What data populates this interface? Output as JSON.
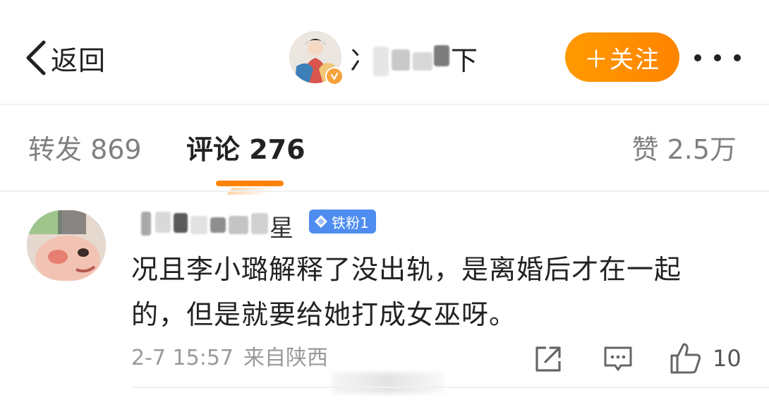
{
  "header": {
    "back_label": "返回",
    "author_name_prefix": "冫",
    "author_name_suffix": "下",
    "follow_label": "＋关注",
    "colors": {
      "accent": "#ff8200",
      "verified": "#f7a23b"
    }
  },
  "tabs": {
    "repost": "转发 869",
    "comment": "评论 276",
    "likes": "赞 2.5万"
  },
  "comment": {
    "username_suffix": "星",
    "fan_badge": "铁粉1",
    "text_line1": "况且李小璐解释了没出轨，是离婚后才在一起",
    "text_line2": "的，但是就要给她打成女巫呀。",
    "timestamp": "2-7 15:57",
    "location": "来自陕西",
    "like_count": "10",
    "badge_color": "#4e8cf0"
  },
  "icons": [
    "back-chevron-icon",
    "verified-icon",
    "more-icon",
    "diamond-icon",
    "share-icon",
    "reply-icon",
    "thumbs-up-icon"
  ]
}
